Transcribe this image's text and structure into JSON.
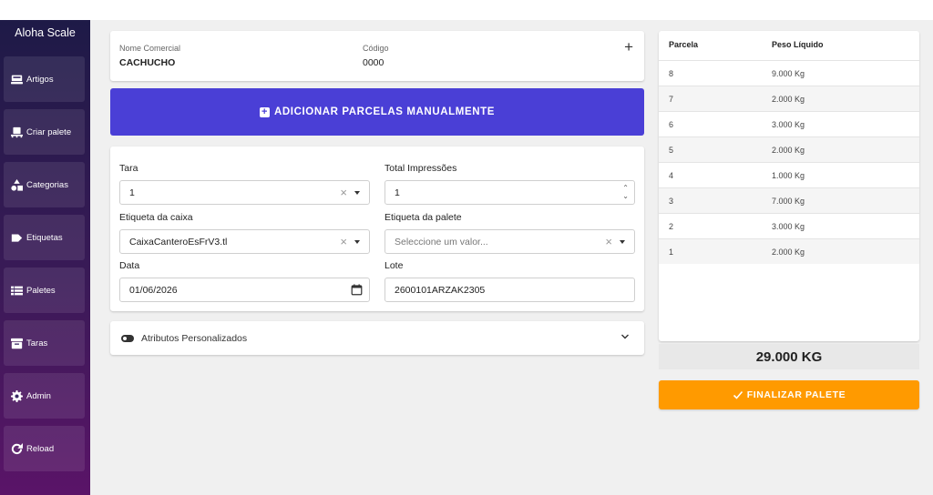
{
  "app": {
    "brand": "Aloha Scale"
  },
  "sidebar": {
    "items": [
      {
        "label": "Artigos",
        "icon": "scale-icon"
      },
      {
        "label": "Criar palete",
        "icon": "pallet-icon"
      },
      {
        "label": "Categorias",
        "icon": "shapes-icon"
      },
      {
        "label": "Etiquetas",
        "icon": "tag-icon"
      },
      {
        "label": "Paletes",
        "icon": "list-icon"
      },
      {
        "label": "Taras",
        "icon": "archive-icon"
      },
      {
        "label": "Admin",
        "icon": "gear-icon"
      },
      {
        "label": "Reload",
        "icon": "reload-icon"
      }
    ]
  },
  "header": {
    "name_label": "Nome Comercial",
    "name_value": "CACHUCHO",
    "code_label": "Código",
    "code_value": "0000"
  },
  "add_button": {
    "label": "ADICIONAR PARCELAS MANUALMENTE"
  },
  "form": {
    "tara": {
      "label": "Tara",
      "value": "1"
    },
    "impressoes": {
      "label": "Total Impressões",
      "value": "1"
    },
    "etiqueta_caixa": {
      "label": "Etiqueta da caixa",
      "value": "CaixaCanteroEsFrV3.tl"
    },
    "etiqueta_palete": {
      "label": "Etiqueta da palete",
      "placeholder": "Seleccione um valor..."
    },
    "data": {
      "label": "Data",
      "value": "01/06/2026"
    },
    "lote": {
      "label": "Lote",
      "value": "2600101ARZAK2305"
    }
  },
  "attributes": {
    "label": "Atributos Personalizados"
  },
  "table": {
    "headers": [
      "Parcela",
      "Peso Líquido"
    ],
    "rows": [
      [
        "8",
        "9.000 Kg"
      ],
      [
        "7",
        "2.000 Kg"
      ],
      [
        "6",
        "3.000 Kg"
      ],
      [
        "5",
        "2.000 Kg"
      ],
      [
        "4",
        "1.000 Kg"
      ],
      [
        "3",
        "7.000 Kg"
      ],
      [
        "2",
        "3.000 Kg"
      ],
      [
        "1",
        "2.000 Kg"
      ]
    ]
  },
  "total": "29.000 KG",
  "finalize": {
    "label": "FINALIZAR PALETE"
  },
  "colors": {
    "primary": "#4a3fd6",
    "accent": "#ff9a00",
    "sidebar": "#2a1a50"
  }
}
